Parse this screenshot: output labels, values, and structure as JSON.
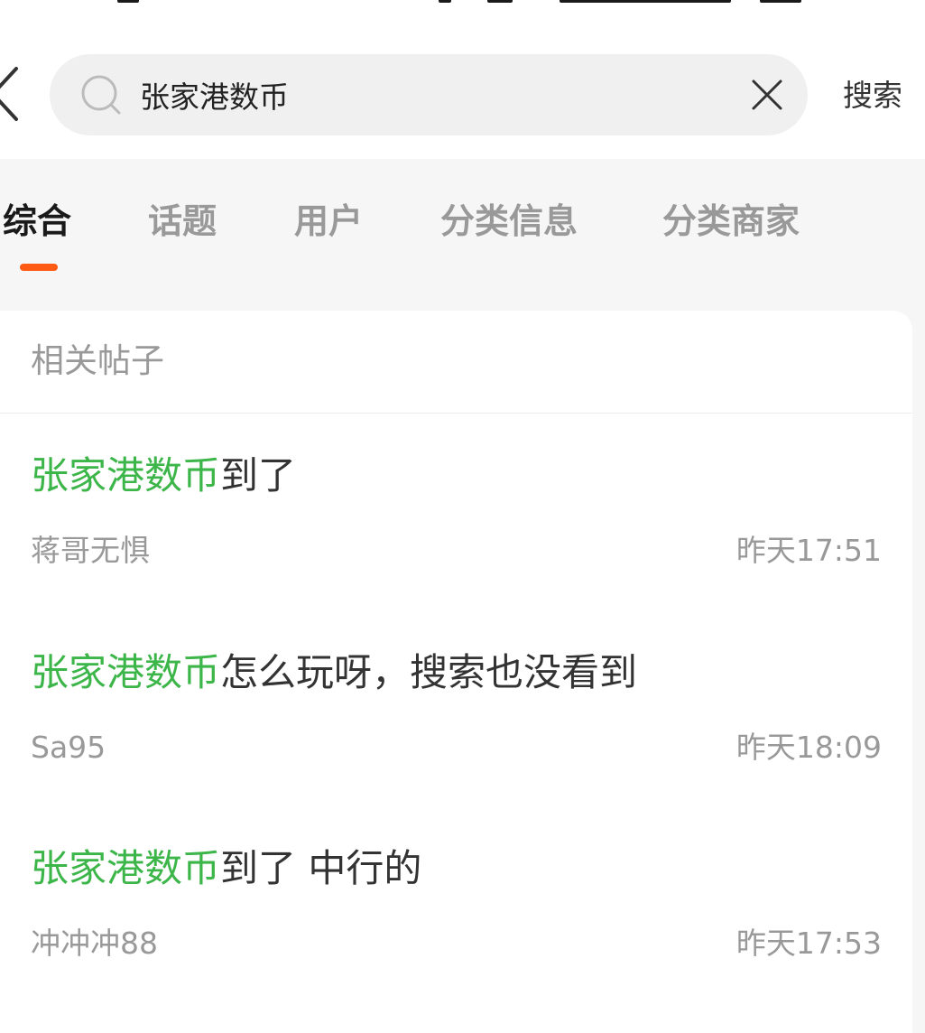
{
  "search": {
    "query": "张家港数币",
    "submit_label": "搜索"
  },
  "icons": {
    "back": "chevron-left-icon",
    "search": "search-icon",
    "clear": "close-icon"
  },
  "tabs": [
    {
      "label": "综合",
      "active": true
    },
    {
      "label": "话题",
      "active": false
    },
    {
      "label": "用户",
      "active": false
    },
    {
      "label": "分类信息",
      "active": false
    },
    {
      "label": "分类商家",
      "active": false
    }
  ],
  "section": {
    "title": "相关帖子"
  },
  "posts": [
    {
      "highlight": "张家港数币",
      "rest": "到了",
      "author": "蒋哥无惧",
      "time": "昨天17:51"
    },
    {
      "highlight": "张家港数币",
      "rest": "怎么玩呀，搜索也没看到",
      "author": "Sa95",
      "time": "昨天18:09"
    },
    {
      "highlight": "张家港数币",
      "rest": "到了 中行的",
      "author": "冲冲冲88",
      "time": "昨天17:53"
    }
  ],
  "colors": {
    "accent": "#ff5a14",
    "highlight": "#3cb549",
    "muted": "#999999"
  }
}
